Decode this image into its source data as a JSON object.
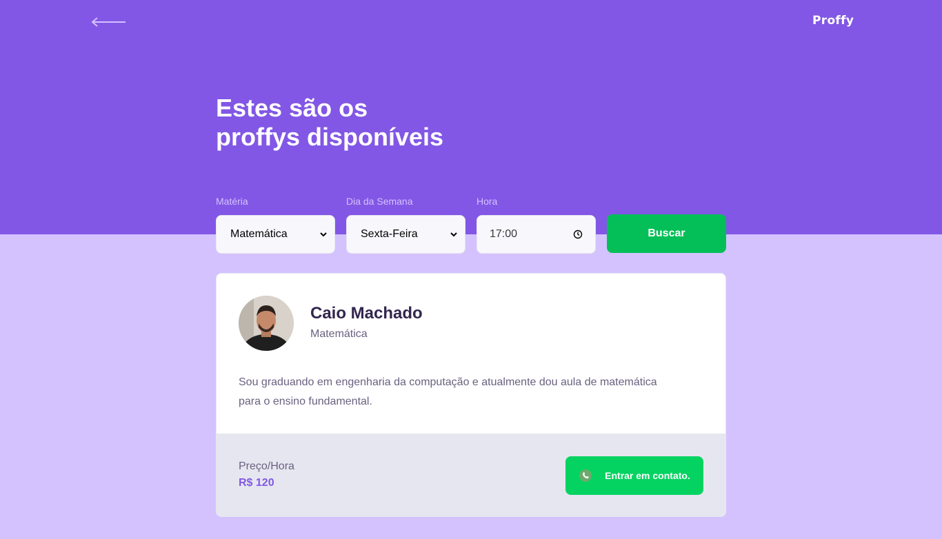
{
  "header": {
    "logo": "Proffy",
    "title_line1": "Estes são os",
    "title_line2": "proffys disponíveis"
  },
  "filters": {
    "subject": {
      "label": "Matéria",
      "value": "Matemática"
    },
    "weekday": {
      "label": "Dia da Semana",
      "value": "Sexta-Feira"
    },
    "time": {
      "label": "Hora",
      "value": "17:00"
    },
    "search_button": "Buscar"
  },
  "teacher": {
    "name": "Caio Machado",
    "subject": "Matemática",
    "bio": "Sou graduando em engenharia da computação e atualmente dou aula de matemática para o ensino fundamental.",
    "price_label": "Preço/Hora",
    "price_value": "R$ 120",
    "contact_button": "Entrar em contato."
  },
  "colors": {
    "primary": "#8257e5",
    "background": "#d4c2ff",
    "secondary": "#04d361"
  },
  "icons": {
    "back": "back-arrow-icon",
    "select": "chevron-down-icon",
    "time": "clock-icon",
    "contact": "whatsapp-icon"
  }
}
